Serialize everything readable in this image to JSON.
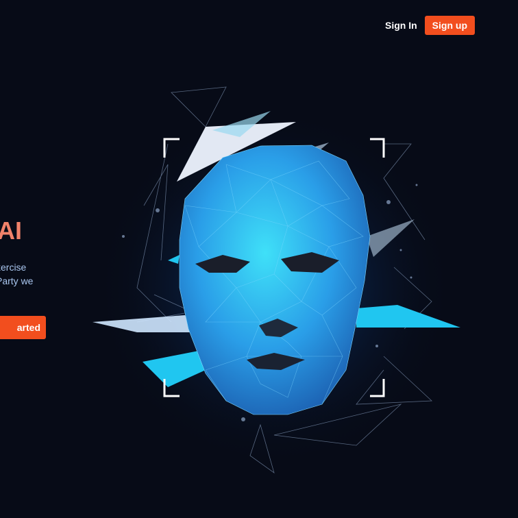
{
  "header": {
    "signin_label": "Sign In",
    "signup_label": "Sign up"
  },
  "hero": {
    "title": "AI",
    "subtitle_line1": "xercise",
    "subtitle_line2": "Party we",
    "cta_label": "arted"
  },
  "colors": {
    "accent": "#f24e1e",
    "background": "#070b17",
    "title": "#f0826a",
    "face": "#2a9ee8"
  },
  "icons": {
    "frame": "corner-bracket-frame-icon",
    "art": "polygon-face-illustration"
  }
}
